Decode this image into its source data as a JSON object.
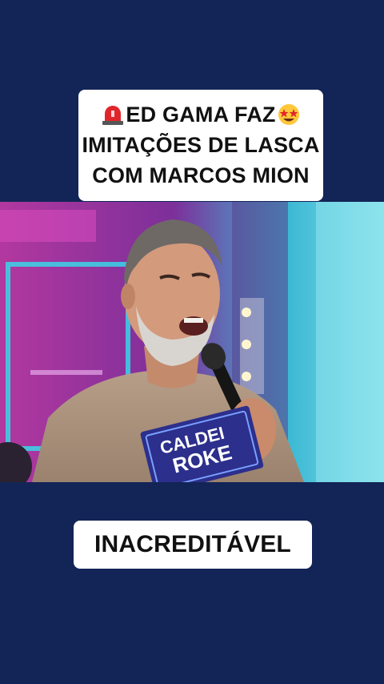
{
  "top_caption": {
    "line1_icon": "siren-emoji",
    "line1_text": "ED GAMA FAZ",
    "line1_icon_end": "star-struck-emoji",
    "line2_text": "IMITAÇÕES DE LASCA",
    "line3_text": "COM MARCOS MION"
  },
  "photo": {
    "description_icon": "tv-host-photo",
    "card_text_line1": "CALDEI",
    "card_text_line2": "ROKE"
  },
  "bottom_caption": {
    "text": "INACREDITÁVEL"
  },
  "colors": {
    "background": "#132456",
    "caption_bg": "#ffffff",
    "caption_text": "#111111"
  }
}
